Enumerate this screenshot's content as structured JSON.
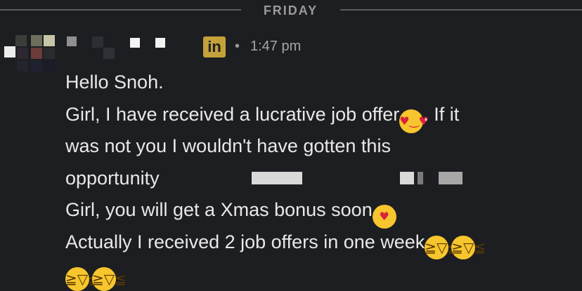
{
  "divider": {
    "label": "FRIDAY"
  },
  "header": {
    "badge_text": "in",
    "separator": "•",
    "time": "1:47 pm"
  },
  "message": {
    "lines": [
      "Hello Snoh.",
      "Girl, I have received a lucrative job offer",
      ". If it",
      "was not you I wouldn't have gotten this",
      "opportunity",
      "Girl, you will get a Xmas bonus soon",
      "Actually I received 2 job offers in one week"
    ]
  },
  "emoji": {
    "heart_eyes": "heart-eyes-emoji",
    "smiling_hearts": "smiling-face-with-hearts-emoji",
    "rofl": "rolling-on-floor-laughing-emoji"
  },
  "colors": {
    "background": "#1d1e22",
    "text": "#e8e8e8",
    "badge": "#c4a13a"
  }
}
